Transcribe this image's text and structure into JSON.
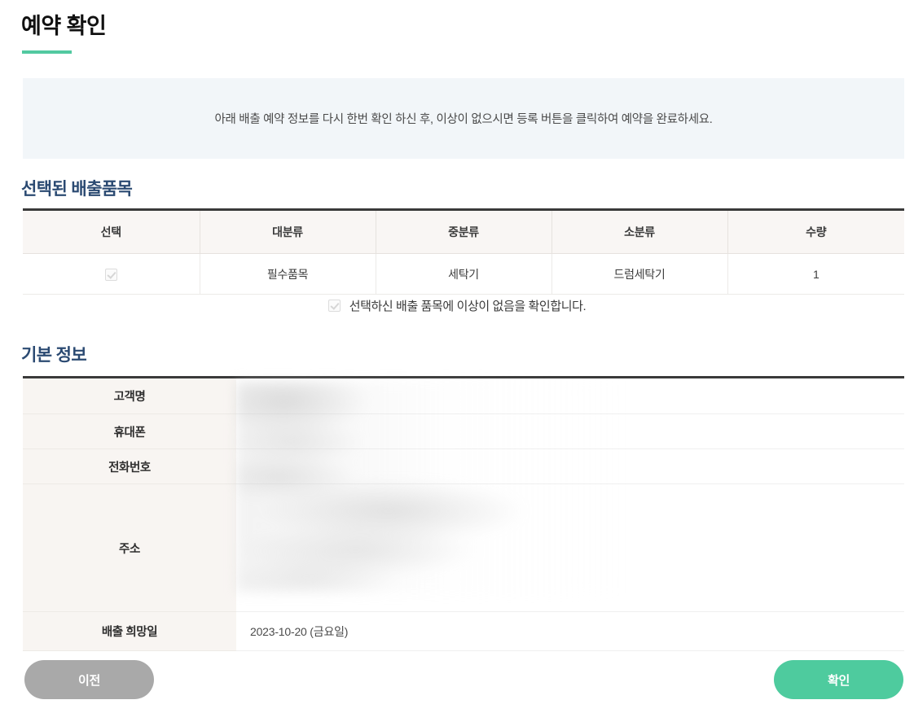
{
  "page": {
    "title": "예약 확인",
    "notice": "아래 배출 예약 정보를 다시 한번 확인 하신 후, 이상이 없으시면 등록 버튼을 클릭하여 예약을 완료하세요.",
    "accent_color": "#52c9a0",
    "heading_color": "#2b4a72"
  },
  "items_section": {
    "heading": "선택된 배출품목",
    "columns": [
      "선택",
      "대분류",
      "중분류",
      "소분류",
      "수량"
    ],
    "rows": [
      {
        "selected": true,
        "major": "필수품목",
        "middle": "세탁기",
        "minor": "드럼세탁기",
        "quantity": "1"
      }
    ],
    "confirm_checkbox": {
      "checked": true,
      "label": "선택하신 배출 품목에 이상이 없음을 확인합니다."
    }
  },
  "basic_info_section": {
    "heading": "기본 정보",
    "rows": [
      {
        "label": "고객명",
        "value": ""
      },
      {
        "label": "휴대폰",
        "value": ""
      },
      {
        "label": "전화번호",
        "value": ""
      },
      {
        "label": "주소",
        "value": ""
      },
      {
        "label": "배출 희망일",
        "value": "2023-10-20 (금요일)"
      }
    ]
  },
  "footer": {
    "prev_label": "이전",
    "confirm_label": "확인",
    "prev_color": "#a9a9a9",
    "confirm_color": "#4ecb9e"
  }
}
